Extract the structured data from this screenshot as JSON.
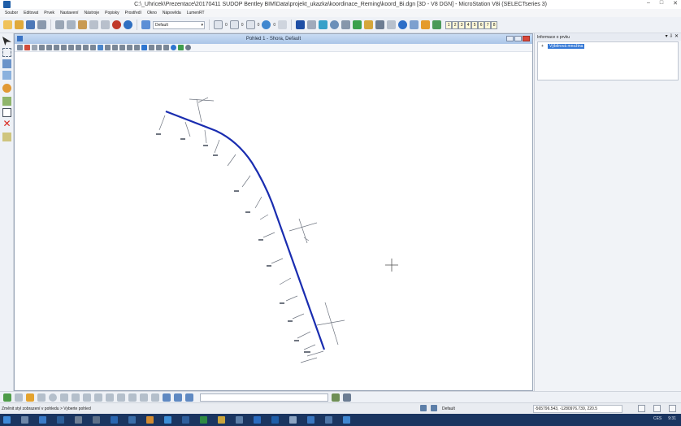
{
  "window": {
    "title": "C:\\_Uhricek\\Prezentace\\20170411 SUDOP Bentley BIM\\Data\\projekt_ukazka\\koordinace_Reming\\koord_Bi.dgn [3D - V8 DGN] - MicroStation V8i (SELECTseries 3)",
    "minimize": "–",
    "maximize": "□",
    "close": "✕"
  },
  "menu": [
    "Soubor",
    "Editovat",
    "Prvek",
    "Nastavení",
    "Nástroje",
    "Popisky",
    "Prostředí",
    "Okno",
    "Nápověda",
    "LumenRT"
  ],
  "toolbar": {
    "level_combo": "Default",
    "values": [
      "0",
      "0",
      "0",
      "0"
    ],
    "view_tabs": [
      "1",
      "2",
      "3",
      "4",
      "5",
      "6",
      "7",
      "8"
    ]
  },
  "view": {
    "title": "Pohled 1 - Shora, Default"
  },
  "right_panel": {
    "title": "Informace o prvku",
    "pin": "▾ ⇩ ✕",
    "tree_node": "Výběrová množina",
    "twist": "+"
  },
  "status": {
    "prompt": "Změnit styl zobrazení v pohledu > Vyberte pohled",
    "level": "Default",
    "coords": "-565796.543, -1280976.739, 220.5"
  },
  "taskbar": {
    "tray_lang": "CES",
    "tray_time": "9:31"
  },
  "colors": {
    "alignment": "#1a2db0",
    "annotation": "#6a6f78",
    "titlebar_bg": "#ffffff",
    "view_title_bg": "#b9d1ee",
    "taskbar_bg": "#1a3560"
  },
  "icons": {
    "cursor": "crosshair-icon",
    "delete": "red-x-icon"
  }
}
